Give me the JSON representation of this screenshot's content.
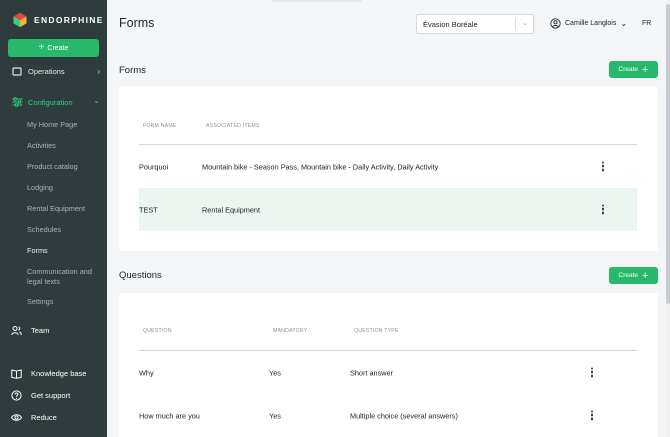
{
  "brand": {
    "name": "ENDORPHINE"
  },
  "sidebar": {
    "create_label": "Create",
    "operations_label": "Operations",
    "configuration_label": "Configuration",
    "sub_items": [
      {
        "label": "My Home Page"
      },
      {
        "label": "Activities"
      },
      {
        "label": "Product catalog"
      },
      {
        "label": "Lodging"
      },
      {
        "label": "Rental Equipment"
      },
      {
        "label": "Schedules"
      },
      {
        "label": "Forms"
      },
      {
        "label": "Communication and"
      },
      {
        "label": "legal texts"
      },
      {
        "label": "Settings"
      }
    ],
    "team_label": "Team",
    "knowledge_label": "Knowledge base",
    "support_label": "Get support",
    "reduce_label": "Reduce"
  },
  "header": {
    "title": "Forms",
    "org_select": "Évasion Boréale",
    "user_name": "Camille Langlois",
    "lang": "FR"
  },
  "forms_section": {
    "title": "Forms",
    "create_label": "Create",
    "columns": [
      "FORM NAME",
      "ASSOCIATED ITEMS"
    ],
    "rows": [
      {
        "name": "Pourquoi",
        "items": "Mountain bike - Season Pass, Mountain bike - Daily Activity, Daily Activity"
      },
      {
        "name": "TEST",
        "items": "Rental Equipment"
      }
    ]
  },
  "questions_section": {
    "title": "Questions",
    "create_label": "Create",
    "columns": [
      "QUESTION",
      "MANDATORY",
      "QUESTION TYPE"
    ],
    "rows": [
      {
        "question": "Why",
        "mandatory": "Yes",
        "type": "Short answer"
      },
      {
        "question": "How much are you",
        "mandatory": "Yes",
        "type": "Multiple choice (several answers)"
      }
    ]
  },
  "colors": {
    "accent": "#27b86b",
    "sidebar_bg": "#2f3c3e",
    "row_highlight": "#edf5f1"
  }
}
